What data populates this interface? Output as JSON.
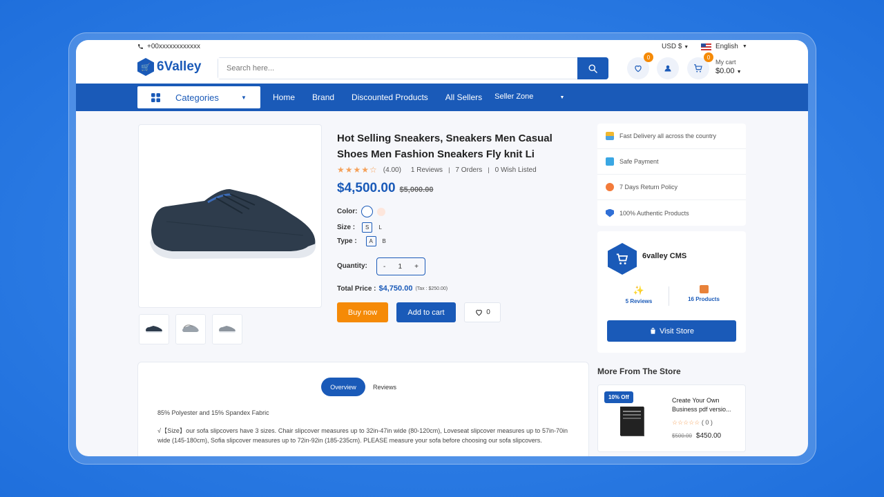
{
  "topbar": {
    "phone": "+00xxxxxxxxxxxx",
    "currency": "USD $",
    "language": "English"
  },
  "header": {
    "logo_text": "6Valley",
    "search_placeholder": "Search here...",
    "wishlist_count": "0",
    "cart_count": "0",
    "cart_label": "My cart",
    "cart_amount": "$0.00"
  },
  "nav": {
    "categories": "Categories",
    "links": [
      "Home",
      "Brand",
      "Discounted Products",
      "All Sellers",
      "Seller Zone"
    ]
  },
  "product": {
    "title": "Hot Selling Sneakers, Sneakers Men Casual Shoes Men Fashion Sneakers Fly knit Li",
    "stars": "★★★★☆",
    "rating": "(4.00)",
    "reviews": "1 Reviews",
    "orders": "7 Orders",
    "wishlisted": "0 Wish Listed",
    "price": "$4,500.00",
    "old_price": "$5,000.00",
    "color_label": "Color:",
    "size_label": "Size :",
    "sizes": [
      "S",
      "L"
    ],
    "type_label": "Type :",
    "types": [
      "A",
      "B"
    ],
    "quantity_label": "Quantity:",
    "quantity": "1",
    "qty_minus": "-",
    "qty_plus": "+",
    "total_label": "Total Price :",
    "total": "$4,750.00",
    "tax": "(Tax : $250.00)",
    "buy_now": "Buy now",
    "add_to_cart": "Add to cart",
    "wish_count": "0"
  },
  "features": [
    "Fast Delivery all across the country",
    "Safe Payment",
    "7 Days Return Policy",
    "100% Authentic Products"
  ],
  "store": {
    "name": "6valley CMS",
    "reviews": "5 Reviews",
    "products": "16 Products",
    "visit": "Visit Store"
  },
  "more": {
    "heading": "More From The Store",
    "badge": "10% Off",
    "title": "Create Your Own Business pdf versio...",
    "stars": "☆☆☆☆☆",
    "count": "( 0 )",
    "old_price": "$500.00",
    "price": "$450.00"
  },
  "overview": {
    "tab_overview": "Overview",
    "tab_reviews": "Reviews",
    "text1": "85% Polyester and 15% Spandex Fabric",
    "text2": "√【Size】our sofa slipcovers have 3 sizes. Chair slipcover measures up to 32in-47in wide (80-120cm), Loveseat slipcover measures up to 57in-70in wide (145-180cm), Sofia slipcover measures up to 72in-92in (185-235cm). PLEASE measure your sofa before choosing our sofa slipcovers."
  },
  "colors": {
    "brand": "#1a5ab8",
    "accent": "#f58a07",
    "star": "#f5a15a"
  }
}
